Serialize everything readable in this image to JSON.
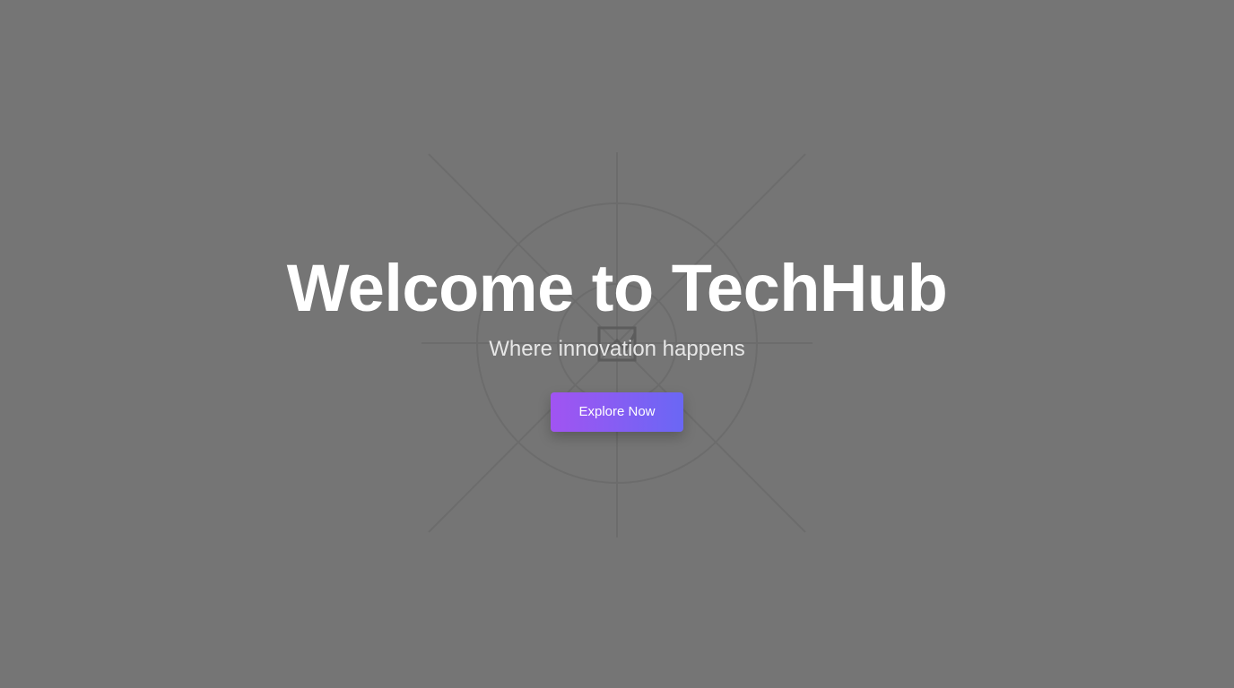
{
  "hero": {
    "title": "Welcome to TechHub",
    "subtitle": "Where innovation happens",
    "cta_label": "Explore Now",
    "background_icon": "broken-image-icon"
  },
  "colors": {
    "page_background": "#757575",
    "title_text": "#ffffff",
    "subtitle_text": "#e6e6e6",
    "button_gradient_start": "#a154f2",
    "button_gradient_end": "#6a67f4",
    "button_text": "#ffffff",
    "placeholder_lines": "#6a6a6a"
  }
}
